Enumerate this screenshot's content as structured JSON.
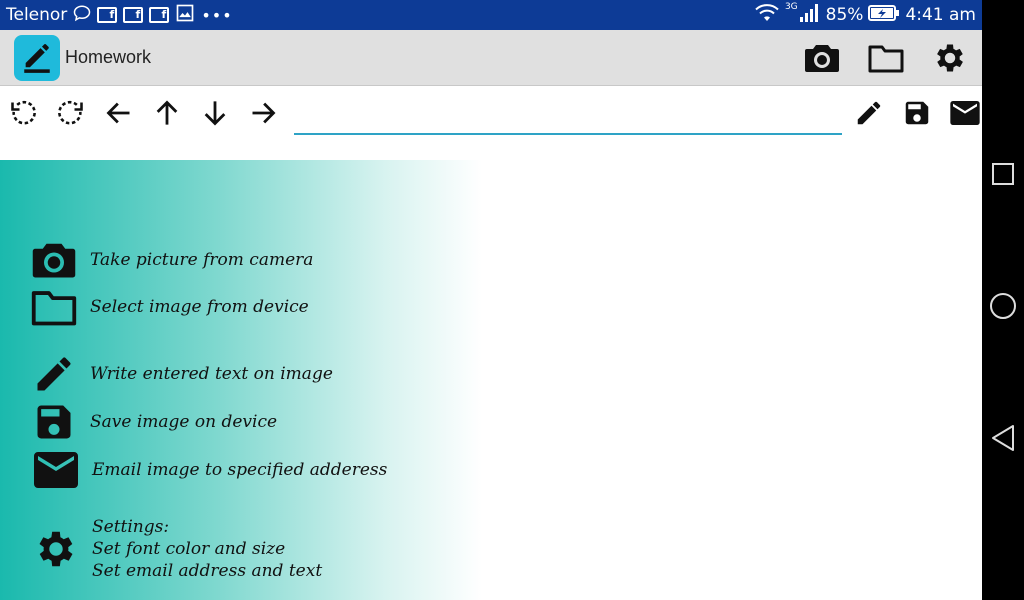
{
  "status_bar": {
    "carrier": "Telenor",
    "network": "3G",
    "battery": "85%",
    "time": "4:41 am",
    "notification_icons": [
      "chat-bubble-icon",
      "facebook-icon",
      "facebook-icon",
      "facebook-icon",
      "image-icon",
      "more-icon"
    ]
  },
  "action_bar": {
    "title": "Homework",
    "actions": [
      "camera-icon",
      "folder-icon",
      "gear-icon",
      "overflow-menu-icon"
    ]
  },
  "toolbar": {
    "text_input_value": "",
    "text_input_placeholder": "",
    "tools": [
      "rotate-left-icon",
      "rotate-right-icon",
      "arrow-left-icon",
      "arrow-up-icon",
      "arrow-down-icon",
      "arrow-right-icon",
      "pencil-icon",
      "save-icon",
      "email-icon"
    ]
  },
  "help": {
    "camera": "Take picture from camera",
    "folder": "Select image from device",
    "write": "Write entered text on image",
    "save": "Save image on device",
    "email": "Email image to specified adderess",
    "settings_line1": "Settings:",
    "settings_line2": "Set font color and size",
    "settings_line3": "Set email address and text"
  },
  "colors": {
    "status_bar": "#0d3b96",
    "action_bar": "#e0e0e0",
    "app_icon": "#1fbadb",
    "input_underline": "#2ea3c6",
    "help_gradient_start": "#1ab9ad"
  }
}
